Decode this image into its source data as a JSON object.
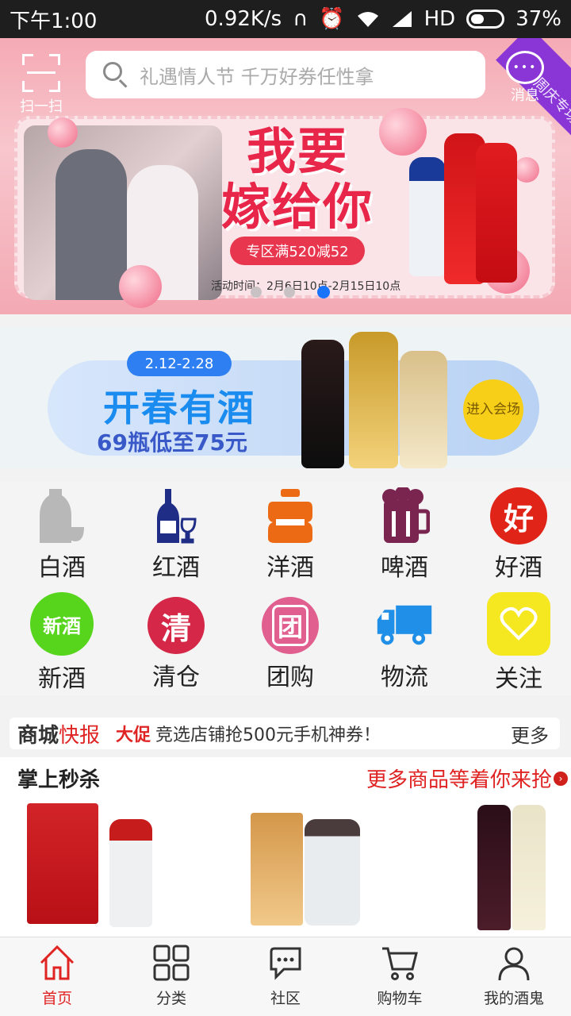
{
  "status_bar": {
    "time": "下午1:00",
    "speed": "0.92K/s",
    "network": "HD",
    "battery": "37%"
  },
  "header": {
    "scan_label": "扫一扫",
    "search_placeholder": "礼遇情人节 千万好券任性拿",
    "message_label": "消息",
    "corner_ribbon": "周庆专场"
  },
  "banner": {
    "title_line1": "我要",
    "title_line2": "嫁给你",
    "offer": "专区满520减52",
    "time": "活动时间：2月6日10点-2月15日10点",
    "slide_count": 3,
    "active_slide": 3
  },
  "promo": {
    "date": "2.12-2.28",
    "title": "开春有酒",
    "subtitle": "69瓶低至75元",
    "enter": "进入会场"
  },
  "categories": [
    {
      "label": "白酒",
      "icon": "baijiu-icon"
    },
    {
      "label": "红酒",
      "icon": "wine-icon"
    },
    {
      "label": "洋酒",
      "icon": "liquor-icon"
    },
    {
      "label": "啤酒",
      "icon": "beer-icon"
    },
    {
      "label": "好酒",
      "icon": "good-icon",
      "glyph": "好"
    },
    {
      "label": "新酒",
      "icon": "new-icon",
      "glyph": "新酒"
    },
    {
      "label": "清仓",
      "icon": "clearance-icon",
      "glyph": "清"
    },
    {
      "label": "团购",
      "icon": "group-buy-icon",
      "glyph": "团"
    },
    {
      "label": "物流",
      "icon": "truck-icon"
    },
    {
      "label": "关注",
      "icon": "heart-icon"
    }
  ],
  "news": {
    "title_a": "商城",
    "title_b": "快报",
    "tag": "大促",
    "text": "竞选店铺抢500元手机神券！",
    "more": "更多"
  },
  "flash_sale": {
    "title": "掌上秒杀",
    "more": "更多商品等着你来抢"
  },
  "tabs": [
    {
      "label": "首页",
      "icon": "home-icon",
      "active": true
    },
    {
      "label": "分类",
      "icon": "grid-icon",
      "active": false
    },
    {
      "label": "社区",
      "icon": "chat-icon",
      "active": false
    },
    {
      "label": "购物车",
      "icon": "cart-icon",
      "active": false
    },
    {
      "label": "我的酒鬼",
      "icon": "user-icon",
      "active": false
    }
  ],
  "colors": {
    "accent": "#e02323",
    "search_bg": "#ffffff",
    "status_bg": "#1e1e1e",
    "dot_active": "#1874ff"
  }
}
